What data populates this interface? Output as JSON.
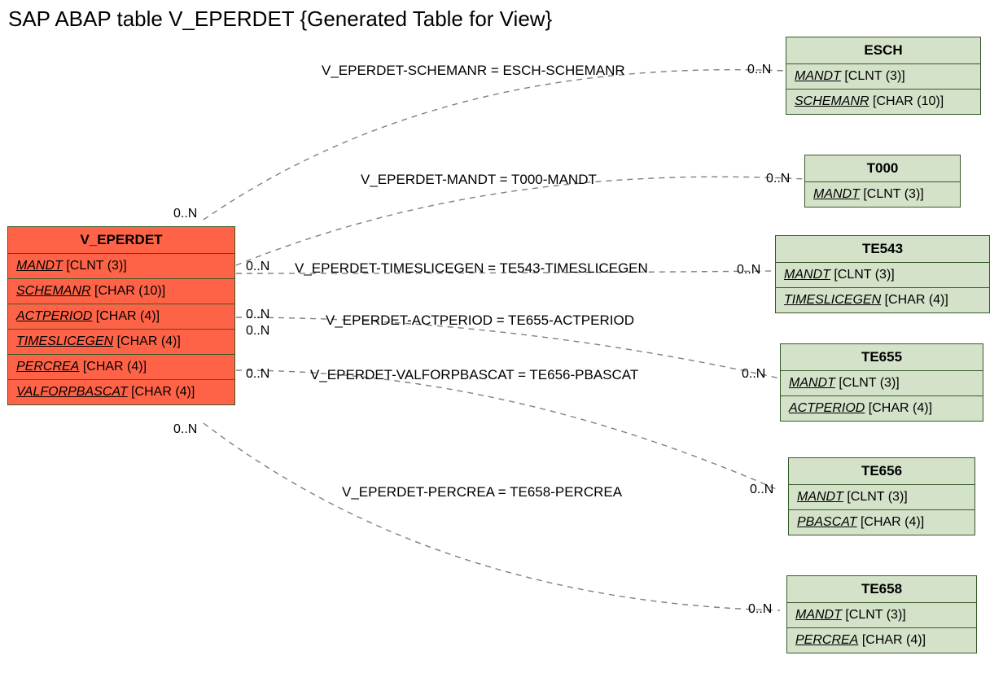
{
  "title": "SAP ABAP table V_EPERDET {Generated Table for View}",
  "main": {
    "name": "V_EPERDET",
    "fields": [
      {
        "name": "MANDT",
        "type": "[CLNT (3)]"
      },
      {
        "name": "SCHEMANR",
        "type": "[CHAR (10)]"
      },
      {
        "name": "ACTPERIOD",
        "type": "[CHAR (4)]"
      },
      {
        "name": "TIMESLICEGEN",
        "type": "[CHAR (4)]"
      },
      {
        "name": "PERCREA",
        "type": "[CHAR (4)]"
      },
      {
        "name": "VALFORPBASCAT",
        "type": "[CHAR (4)]"
      }
    ]
  },
  "refs": {
    "esch": {
      "name": "ESCH",
      "fields": [
        {
          "name": "MANDT",
          "type": "[CLNT (3)]"
        },
        {
          "name": "SCHEMANR",
          "type": "[CHAR (10)]"
        }
      ]
    },
    "t000": {
      "name": "T000",
      "fields": [
        {
          "name": "MANDT",
          "type": "[CLNT (3)]"
        }
      ]
    },
    "te543": {
      "name": "TE543",
      "fields": [
        {
          "name": "MANDT",
          "type": "[CLNT (3)]"
        },
        {
          "name": "TIMESLICEGEN",
          "type": "[CHAR (4)]"
        }
      ]
    },
    "te655": {
      "name": "TE655",
      "fields": [
        {
          "name": "MANDT",
          "type": "[CLNT (3)]"
        },
        {
          "name": "ACTPERIOD",
          "type": "[CHAR (4)]"
        }
      ]
    },
    "te656": {
      "name": "TE656",
      "fields": [
        {
          "name": "MANDT",
          "type": "[CLNT (3)]"
        },
        {
          "name": "PBASCAT",
          "type": "[CHAR (4)]"
        }
      ]
    },
    "te658": {
      "name": "TE658",
      "fields": [
        {
          "name": "MANDT",
          "type": "[CLNT (3)]"
        },
        {
          "name": "PERCREA",
          "type": "[CHAR (4)]"
        }
      ]
    }
  },
  "rels": {
    "r1": {
      "label": "V_EPERDET-SCHEMANR = ESCH-SCHEMANR",
      "left_card": "0..N",
      "right_card": "0..N"
    },
    "r2": {
      "label": "V_EPERDET-MANDT = T000-MANDT",
      "left_card": "0..N",
      "right_card": "0..N"
    },
    "r3": {
      "label": "V_EPERDET-TIMESLICEGEN = TE543-TIMESLICEGEN",
      "left_card": "0..N",
      "right_card": "0..N"
    },
    "r4": {
      "label": "V_EPERDET-ACTPERIOD = TE655-ACTPERIOD",
      "left_card": "0..N",
      "right_card": "0..N"
    },
    "r5": {
      "label": "V_EPERDET-VALFORPBASCAT = TE656-PBASCAT",
      "left_card": "0..N",
      "right_card": "0..N"
    },
    "r6": {
      "label": "V_EPERDET-PERCREA = TE658-PERCREA",
      "left_card": "0..N",
      "right_card": "0..N"
    }
  }
}
